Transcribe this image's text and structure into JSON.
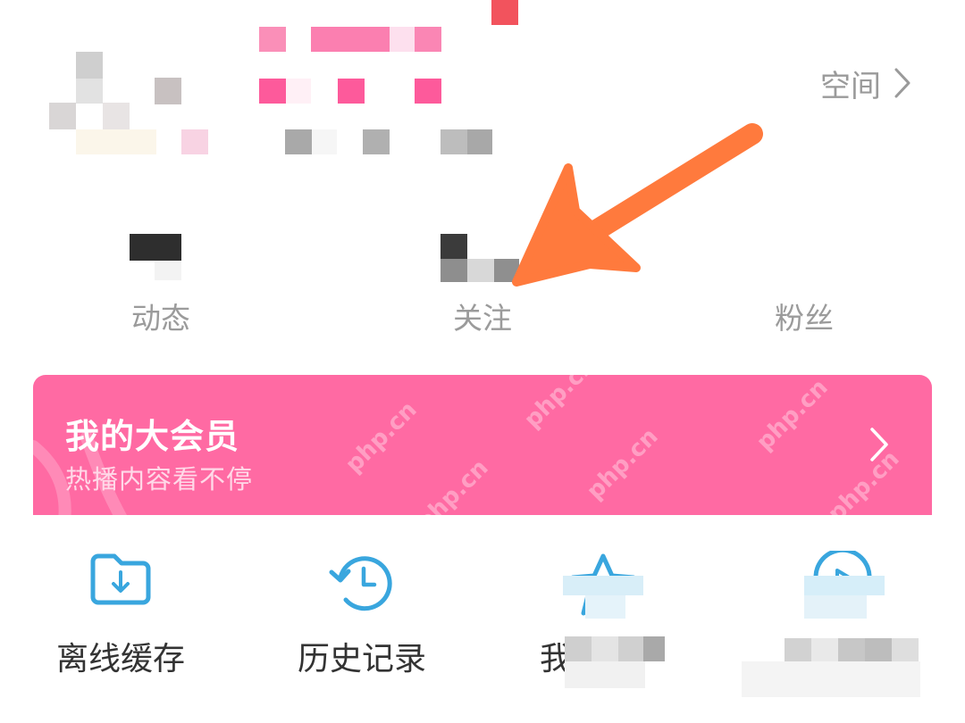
{
  "header": {
    "space_label": "空间"
  },
  "stats": [
    {
      "label": "动态"
    },
    {
      "label": "关注"
    },
    {
      "label": "粉丝"
    }
  ],
  "vip": {
    "title": "我的大会员",
    "subtitle": "热播内容看不停",
    "watermark": "php.cn"
  },
  "grid": [
    {
      "label": "离线缓存",
      "icon": "download-folder-icon"
    },
    {
      "label": "历史记录",
      "icon": "history-clock-icon"
    },
    {
      "label": "我",
      "icon": "star-icon"
    },
    {
      "label": "",
      "icon": "play-circle-icon"
    }
  ],
  "colors": {
    "brand_pink": "#ff6aa3",
    "icon_blue": "#39a6de",
    "arrow_orange": "#ff7a3d",
    "muted_text": "#9b9b9b"
  }
}
